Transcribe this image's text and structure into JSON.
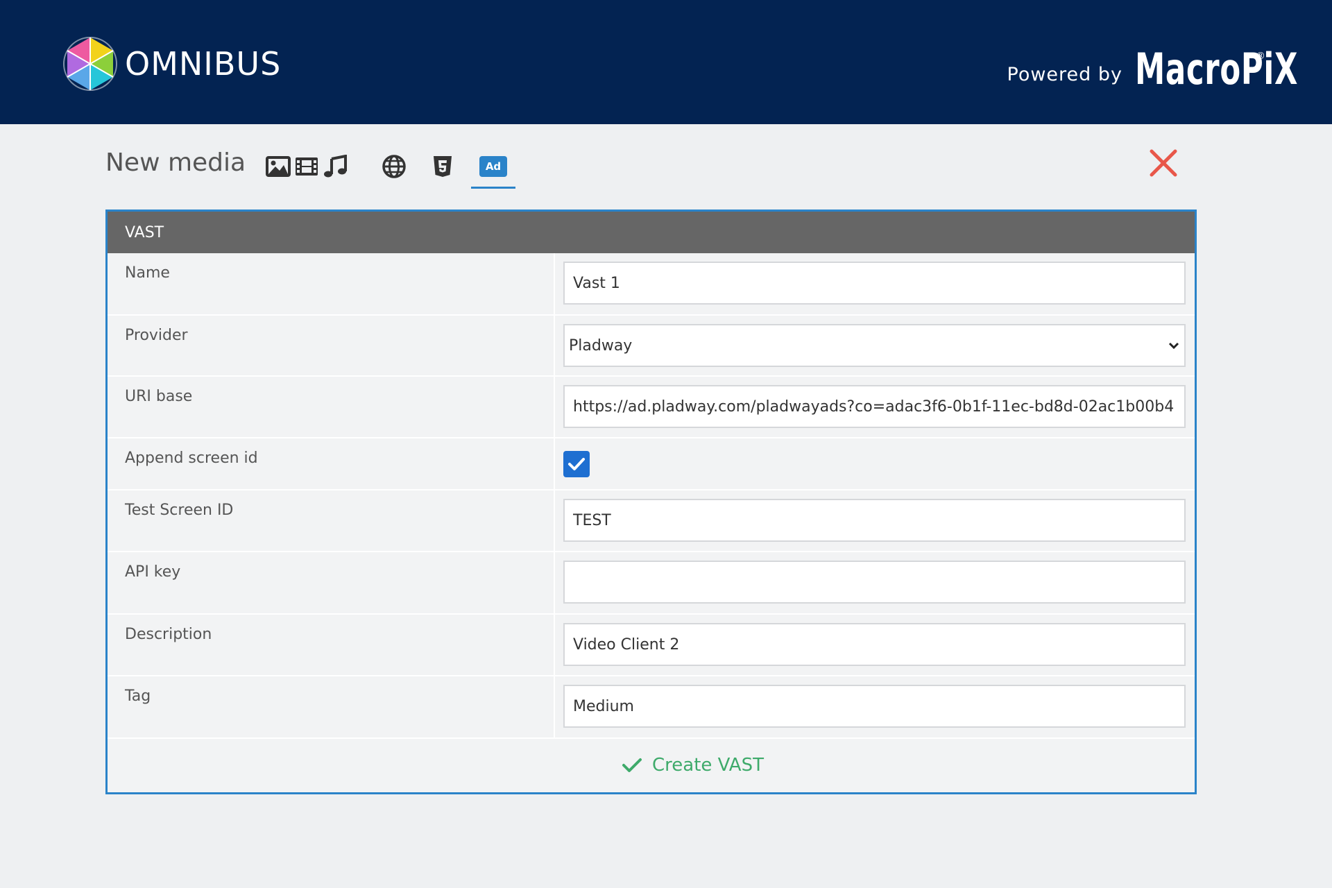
{
  "header": {
    "logo_text": "OMNIBUS",
    "powered_by": "Powered by",
    "brand": "MacroPiX",
    "brand_mark": "®"
  },
  "toolbar": {
    "title": "New media",
    "icons": [
      "image-icon",
      "film-icon",
      "music-icon",
      "globe-icon",
      "html5-icon",
      "ad-icon"
    ],
    "ad_label": "Ad",
    "active_icon": "ad-icon"
  },
  "form": {
    "section_title": "VAST",
    "fields": {
      "name": {
        "label": "Name",
        "value": "Vast 1"
      },
      "provider": {
        "label": "Provider",
        "value": "Pladway"
      },
      "uri_base": {
        "label": "URI base",
        "value": "https://ad.pladway.com/pladwayads?co=adac3f6-0b1f-11ec-bd8d-02ac1b00b4"
      },
      "append_screen_id": {
        "label": "Append screen id",
        "checked": true
      },
      "test_screen_id": {
        "label": "Test Screen ID",
        "value": "TEST"
      },
      "api_key": {
        "label": "API key",
        "value": ""
      },
      "description": {
        "label": "Description",
        "value": "Video Client 2"
      },
      "tag": {
        "label": "Tag",
        "value": "Medium"
      }
    },
    "submit_label": "Create VAST"
  },
  "colors": {
    "header_bg": "#032352",
    "accent": "#2a83c9",
    "close": "#e8574a",
    "success": "#3eaa6a",
    "section_header": "#666666"
  }
}
